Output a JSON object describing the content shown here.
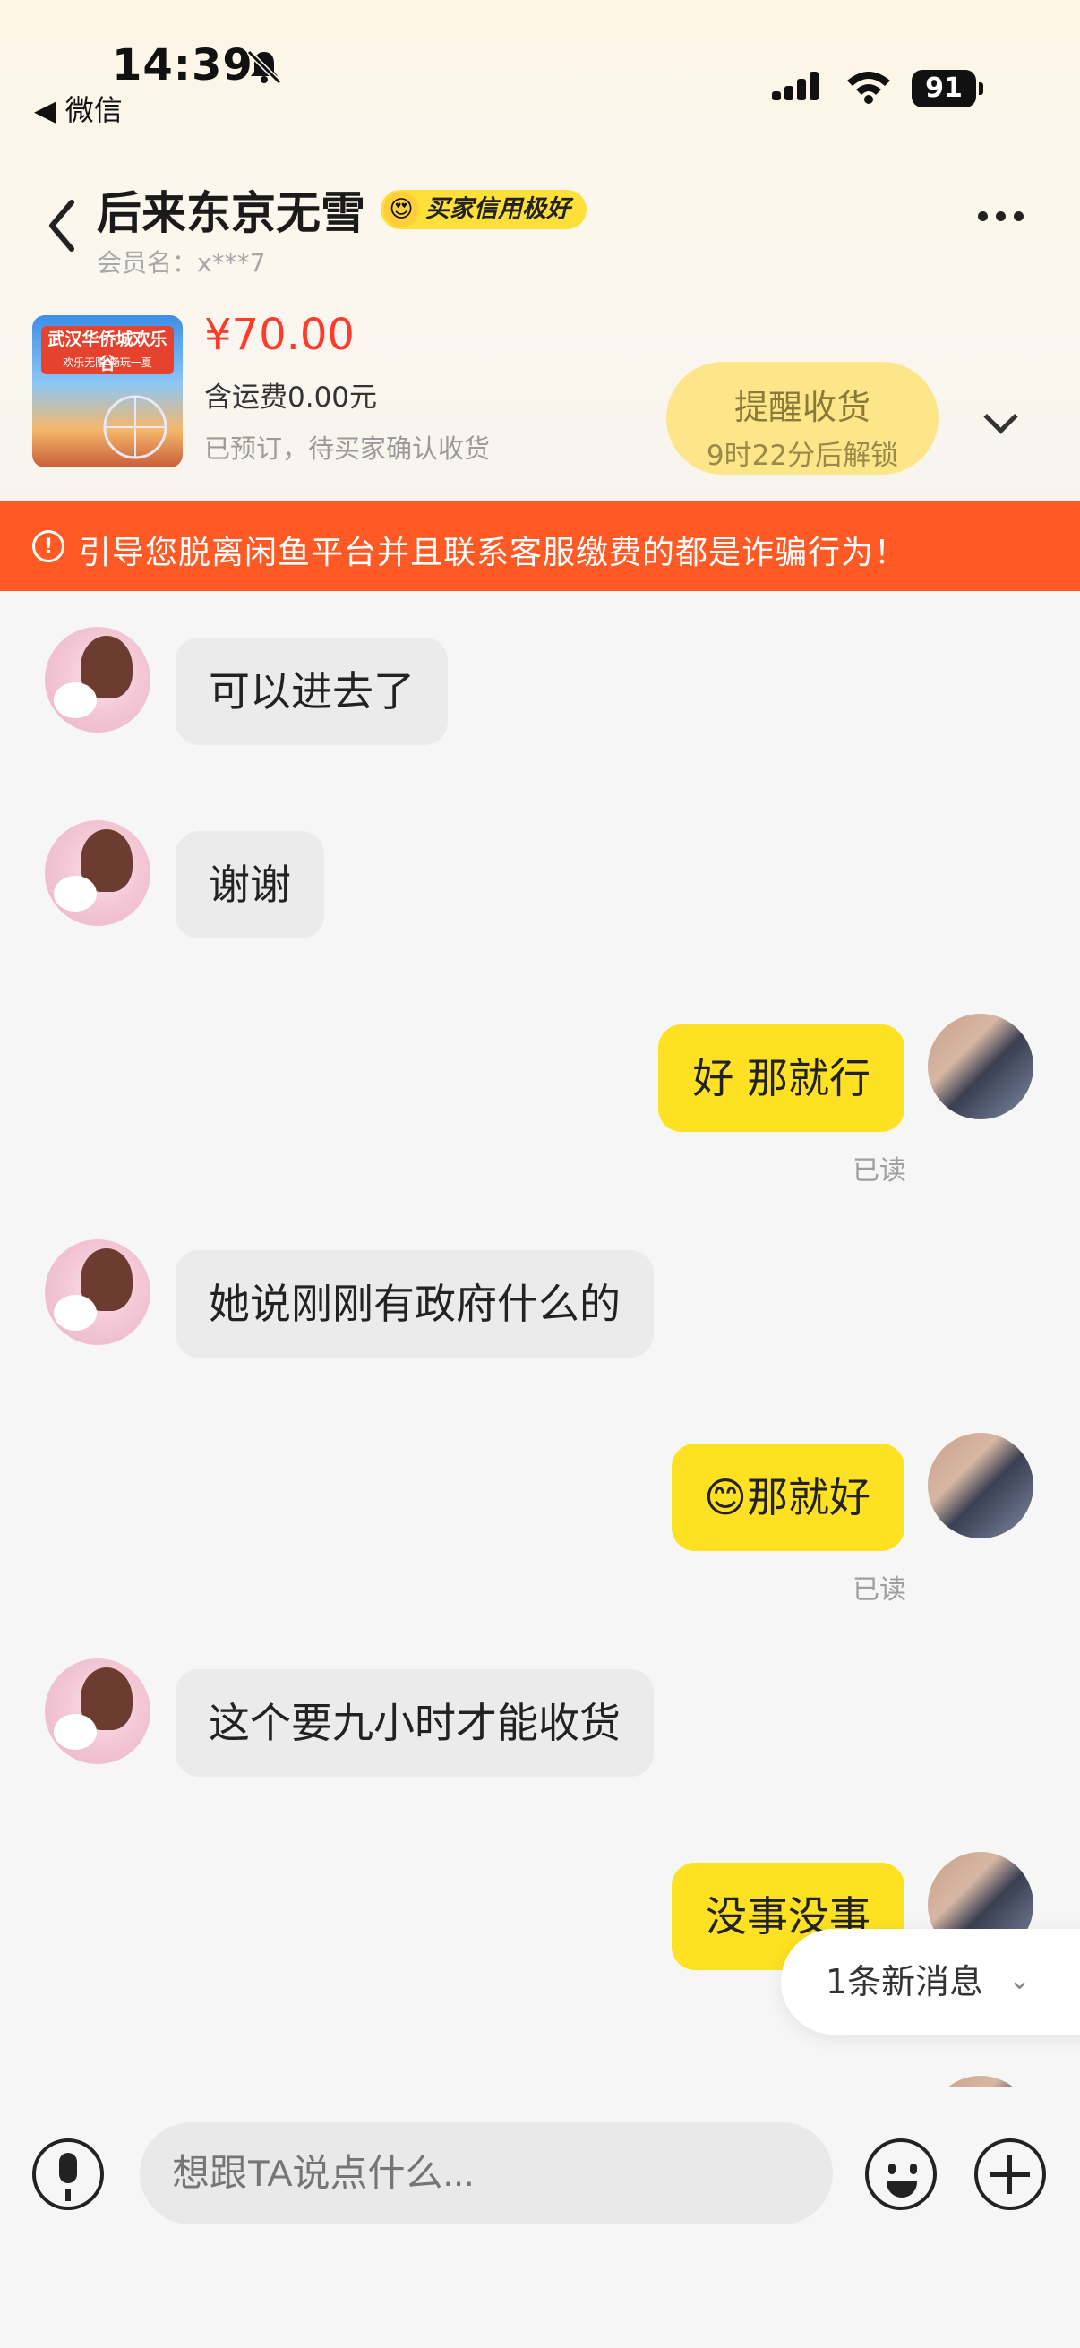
{
  "status_bar": {
    "time": "14:39",
    "back_app": "◀ 微信",
    "battery": "91"
  },
  "header": {
    "title": "后来东京无雪",
    "badge": "买家信用极好",
    "badge_emoji": "😍",
    "member": "会员名：x***7"
  },
  "product": {
    "image_title": "武汉华侨城欢乐谷",
    "image_subtitle": "欢乐无限 畅玩一夏",
    "price": "¥70.00",
    "shipping": "含运费0.00元",
    "status": "已预订，待买家确认收货",
    "remind_label": "提醒收货",
    "remind_sub": "9时22分后解锁"
  },
  "warning": {
    "icon": "!",
    "text": "引导您脱离闲鱼平台并且联系客服缴费的都是诈骗行为！"
  },
  "messages": [
    {
      "side": "left",
      "text": "可以进去了"
    },
    {
      "side": "left",
      "text": "谢谢"
    },
    {
      "side": "right",
      "text": "好 那就行",
      "read": "已读"
    },
    {
      "side": "left",
      "text": "她说刚刚有政府什么的"
    },
    {
      "side": "right",
      "text": "那就好",
      "emoji": "😊",
      "read": "已读"
    },
    {
      "side": "left",
      "text": "这个要九小时才能收货"
    },
    {
      "side": "right",
      "text": "没事没事"
    }
  ],
  "new_message": {
    "label": "1条新消息",
    "arrow": "⌄"
  },
  "input": {
    "placeholder": "想跟TA说点什么..."
  }
}
